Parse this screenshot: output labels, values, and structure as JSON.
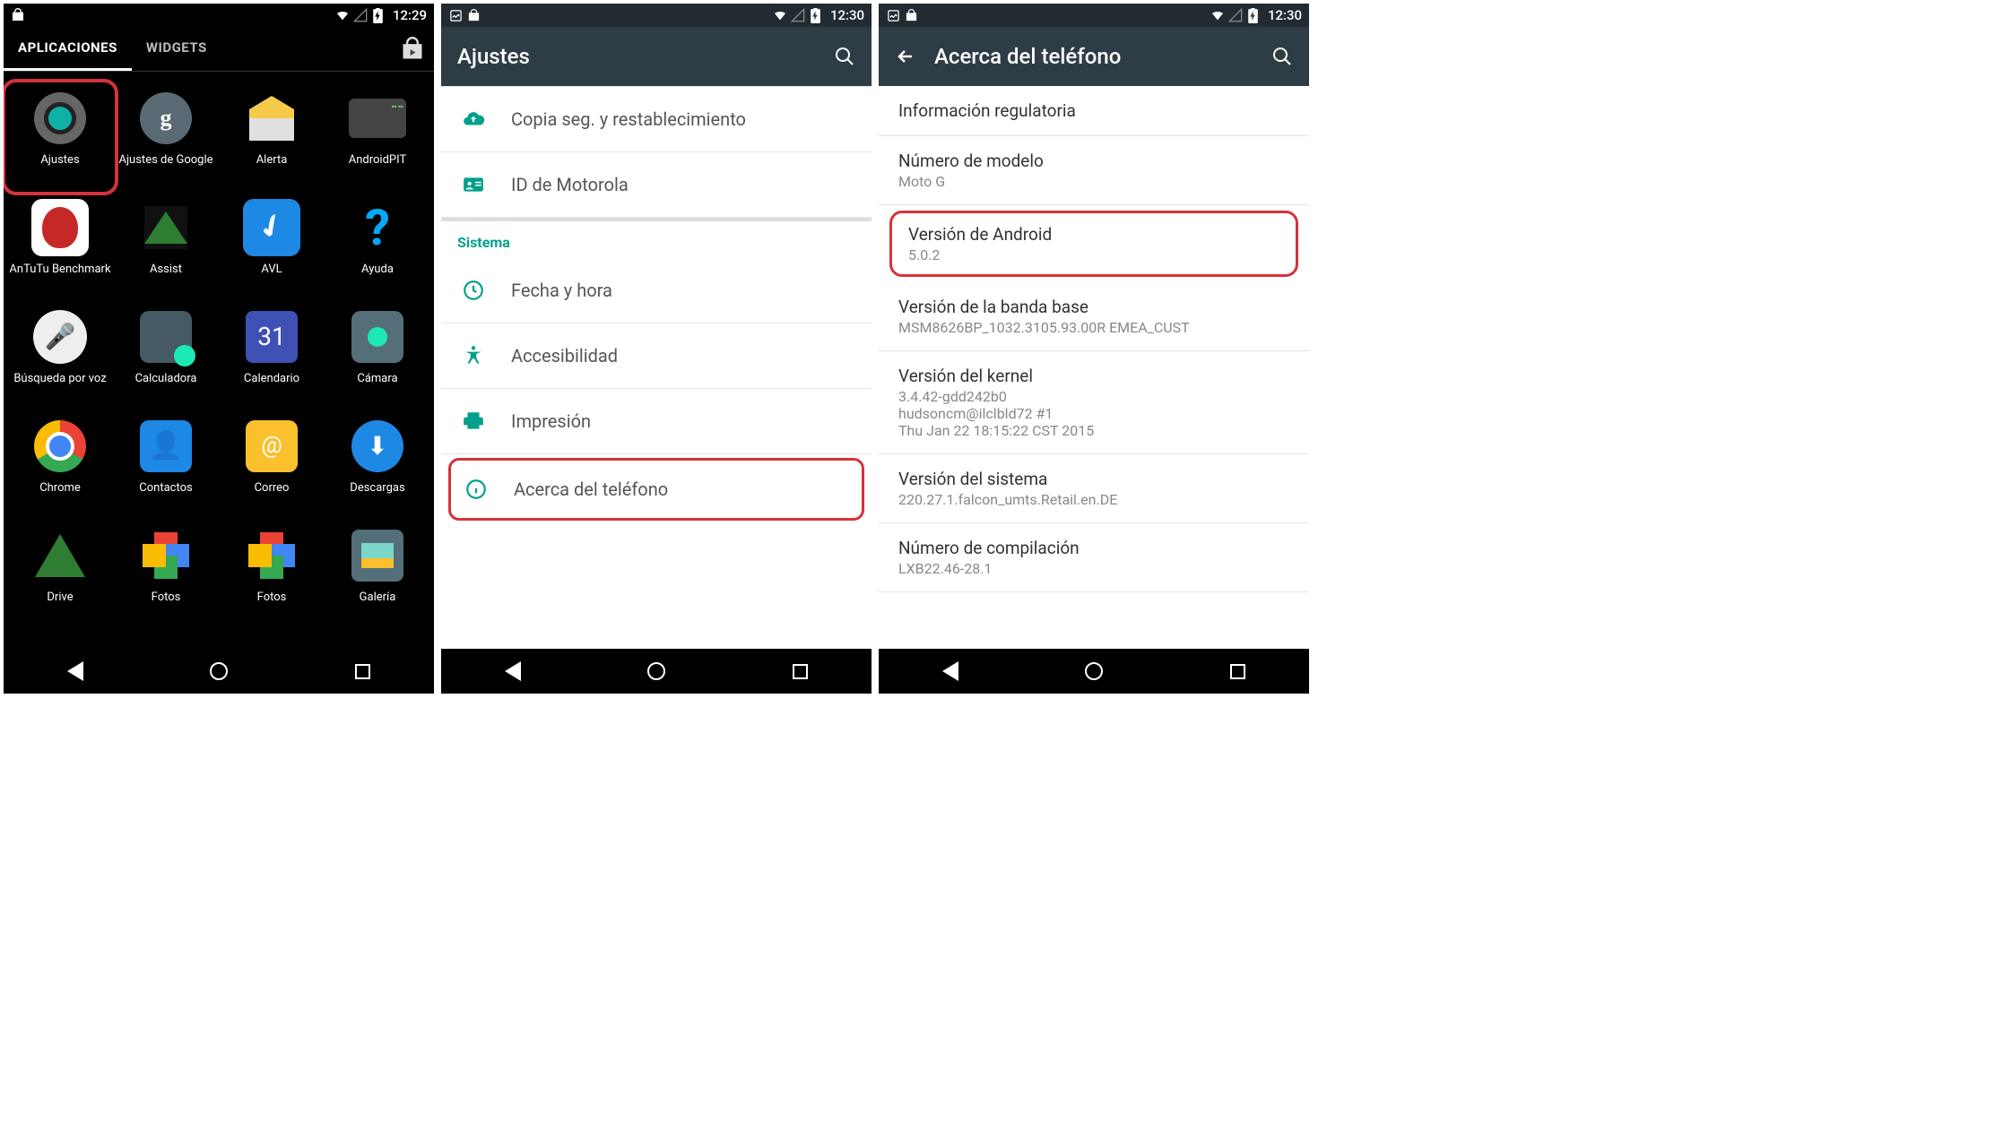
{
  "screen1": {
    "status": {
      "time": "12:29"
    },
    "tabs": {
      "applications": "APLICACIONES",
      "widgets": "WIDGETS"
    },
    "apps": [
      {
        "name": "Ajustes",
        "icon": "settings",
        "highlight": true
      },
      {
        "name": "Ajustes de Google",
        "icon": "google-settings"
      },
      {
        "name": "Alerta",
        "icon": "alert"
      },
      {
        "name": "AndroidPIT",
        "icon": "androidpit"
      },
      {
        "name": "AnTuTu Benchmark",
        "icon": "antutu"
      },
      {
        "name": "Assist",
        "icon": "assist"
      },
      {
        "name": "AVL",
        "icon": "avl"
      },
      {
        "name": "Ayuda",
        "icon": "help"
      },
      {
        "name": "Búsqueda por voz",
        "icon": "voice"
      },
      {
        "name": "Calculadora",
        "icon": "calc"
      },
      {
        "name": "Calendario",
        "icon": "calendar",
        "badge": "31"
      },
      {
        "name": "Cámara",
        "icon": "camera"
      },
      {
        "name": "Chrome",
        "icon": "chrome"
      },
      {
        "name": "Contactos",
        "icon": "contacts"
      },
      {
        "name": "Correo",
        "icon": "mail"
      },
      {
        "name": "Descargas",
        "icon": "download"
      },
      {
        "name": "Drive",
        "icon": "drive"
      },
      {
        "name": "Fotos",
        "icon": "photos"
      },
      {
        "name": "Fotos",
        "icon": "photos"
      },
      {
        "name": "Galería",
        "icon": "gallery"
      }
    ]
  },
  "screen2": {
    "status": {
      "time": "12:30"
    },
    "title": "Ajustes",
    "rows_top": [
      {
        "icon": "cloud-upload-icon",
        "label": "Copia seg. y restablecimiento"
      },
      {
        "icon": "id-card-icon",
        "label": "ID de Motorola"
      }
    ],
    "section": "Sistema",
    "rows_sys": [
      {
        "icon": "clock-icon",
        "label": "Fecha y hora"
      },
      {
        "icon": "accessibility-icon",
        "label": "Accesibilidad"
      },
      {
        "icon": "print-icon",
        "label": "Impresión"
      },
      {
        "icon": "info-icon",
        "label": "Acerca del teléfono",
        "highlight": true
      }
    ]
  },
  "screen3": {
    "status": {
      "time": "12:30"
    },
    "title": "Acerca del teléfono",
    "rows": [
      {
        "primary": "Información regulatoria"
      },
      {
        "primary": "Número de modelo",
        "secondary": "Moto G"
      },
      {
        "primary": "Versión de Android",
        "secondary": "5.0.2",
        "highlight": true
      },
      {
        "primary": "Versión de la banda base",
        "secondary": "MSM8626BP_1032.3105.93.00R EMEA_CUST"
      },
      {
        "primary": "Versión del kernel",
        "secondary": "3.4.42-gdd242b0\nhudsoncm@ilclbld72 #1\nThu Jan 22 18:15:22 CST 2015"
      },
      {
        "primary": "Versión del sistema",
        "secondary": "220.27.1.falcon_umts.Retail.en.DE"
      },
      {
        "primary": "Número de compilación",
        "secondary": "LXB22.46-28.1"
      }
    ]
  }
}
